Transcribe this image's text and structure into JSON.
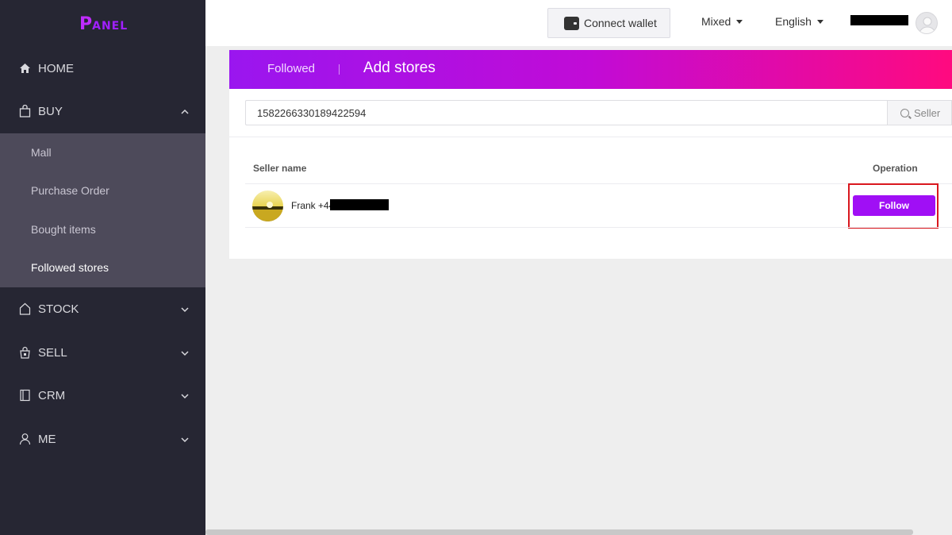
{
  "brand": {
    "logo_first": "P",
    "logo_rest": "ANEL"
  },
  "sidebar": {
    "items": [
      {
        "label": "HOME",
        "icon": "home-icon"
      },
      {
        "label": "BUY",
        "icon": "shopping-bag-icon"
      },
      {
        "label": "STOCK",
        "icon": "house-outline-icon"
      },
      {
        "label": "SELL",
        "icon": "bag-lock-icon"
      },
      {
        "label": "CRM",
        "icon": "notebook-icon"
      },
      {
        "label": "ME",
        "icon": "user-icon"
      }
    ],
    "buy_submenu": [
      {
        "label": "Mall"
      },
      {
        "label": "Purchase Order"
      },
      {
        "label": "Bought items"
      },
      {
        "label": "Followed stores",
        "active": true
      }
    ]
  },
  "header": {
    "wallet_label": "Connect wallet",
    "mode_label": "Mixed",
    "language_label": "English"
  },
  "tabs": {
    "followed_label": "Followed",
    "add_label": "Add stores"
  },
  "search": {
    "value": "1582266330189422594",
    "button_label": "Seller"
  },
  "table": {
    "columns": [
      "Seller name",
      "Operation"
    ],
    "rows": [
      {
        "seller_name": "Frank +44",
        "action_label": "Follow"
      }
    ]
  },
  "colors": {
    "sidebar_bg": "#262633",
    "submenu_bg": "#4d4a5a",
    "accent_purple": "#a00ff5",
    "gradient_start": "#9a16ef",
    "gradient_end": "#ff0a7f",
    "highlight_red": "#d9171e"
  }
}
